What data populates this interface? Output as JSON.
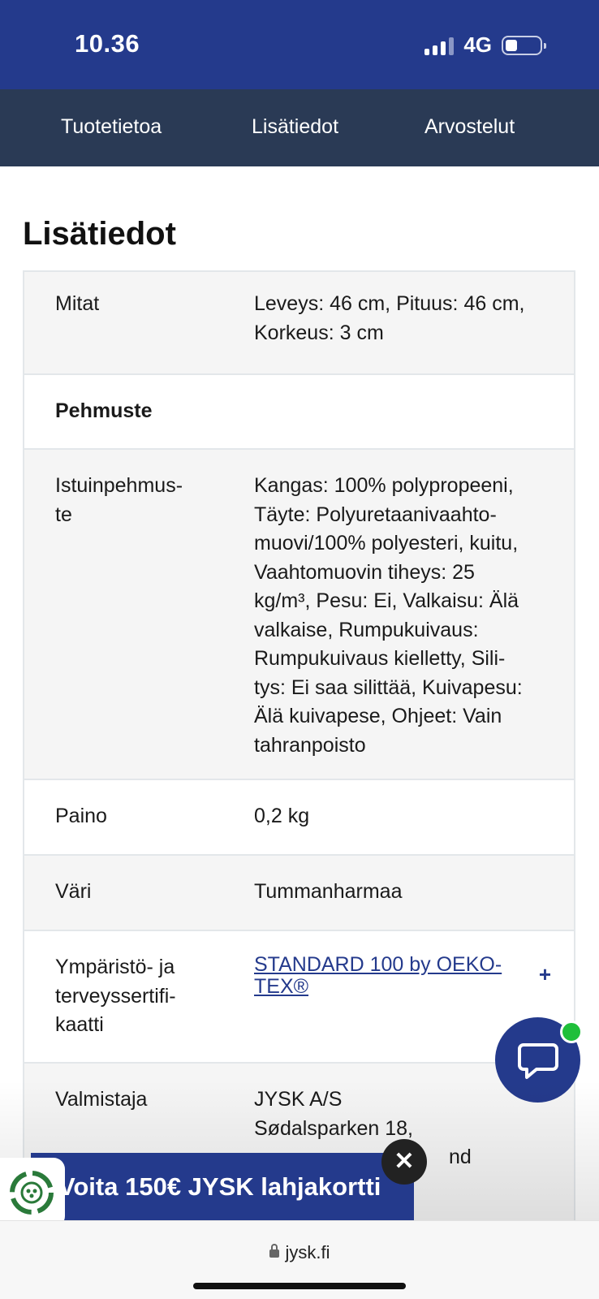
{
  "status": {
    "time": "10.36",
    "network": "4G"
  },
  "tabs": [
    {
      "label": "Tuotetietoa"
    },
    {
      "label": "Lisätiedot"
    },
    {
      "label": "Arvostelut"
    }
  ],
  "heading": "Lisätiedot",
  "rows": [
    {
      "label": "Mitat",
      "value_lines": [
        "Leveys: 46 cm, Pituus: 46 cm,",
        "Korkeus: 3 cm"
      ]
    },
    {
      "label": "Pehmuste"
    },
    {
      "label_lines": [
        "Istuinpehmus-",
        "te"
      ],
      "value_lines": [
        "Kangas: 100% polypropeeni,",
        "Täyte: Polyuretaanivaahto-",
        "muovi/100% polyesteri, kuitu,",
        "Vaahtomuovin tiheys: 25",
        "kg/m³, Pesu: Ei, Valkaisu: Älä",
        "valkaise, Rumpukuivaus:",
        "Rumpukuivaus kielletty, Sili-",
        "tys: Ei saa silittää, Kuivapesu:",
        "Älä kuivapese, Ohjeet: Vain",
        "tahranpoisto"
      ]
    },
    {
      "label": "Paino",
      "value": "0,2 kg"
    },
    {
      "label": "Väri",
      "value": "Tummanharmaa"
    },
    {
      "label_lines": [
        "Ympäristö- ja",
        "terveyssertifi-",
        "kaatti"
      ],
      "link_lines": [
        "STANDARD 100 by OEKO-",
        "TEX®"
      ],
      "expand": "+"
    },
    {
      "label": "Valmistaja",
      "value_lines": [
        "JYSK A/S",
        "Sødalsparken 18,",
        "nd"
      ]
    }
  ],
  "banner": {
    "text": "Voita 150€ JYSK lahjakortti",
    "close": "✕"
  },
  "browser": {
    "url": "jysk.fi"
  },
  "colors": {
    "brand_blue": "#243a8c",
    "tab_bar": "#2a3a55",
    "row_gray": "#f5f5f5",
    "online_dot": "#1fbf3a"
  }
}
